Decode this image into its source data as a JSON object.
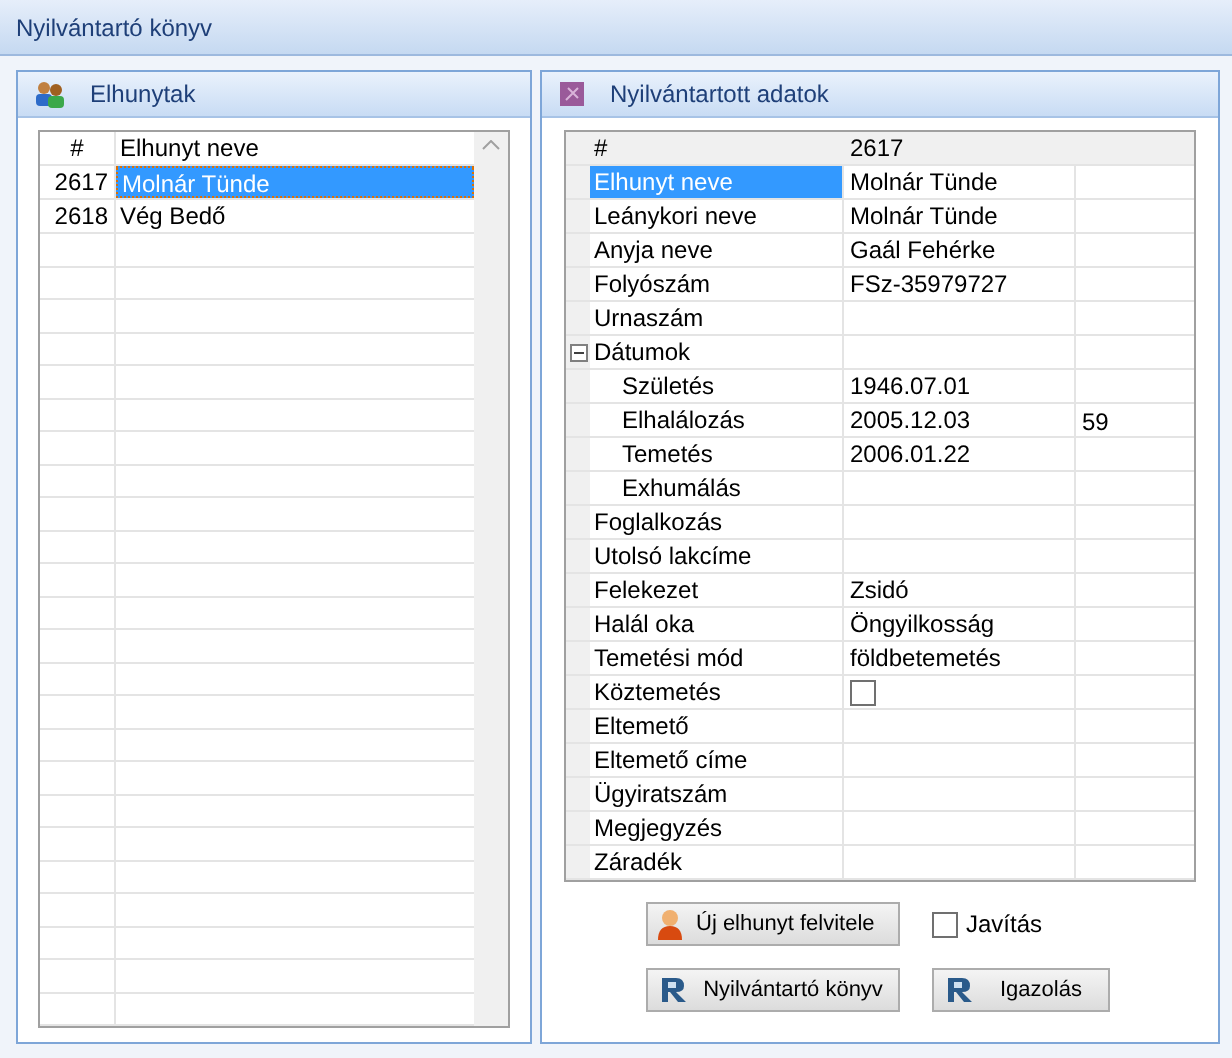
{
  "window": {
    "title": "Nyilvántartó könyv"
  },
  "left_panel": {
    "title": "Elhunytak",
    "columns": [
      "#",
      "Elhunyt neve"
    ],
    "rows": [
      {
        "id": "2617",
        "name": "Molnár Tünde",
        "selected": true
      },
      {
        "id": "2618",
        "name": "Vég Bedő",
        "selected": false
      }
    ]
  },
  "right_panel": {
    "title": "Nyilvántartott adatok",
    "header": {
      "label": "#",
      "value": "2617"
    },
    "properties": [
      {
        "kind": "text",
        "label": "Elhunyt neve",
        "value": "Molnár Tünde",
        "selected": true
      },
      {
        "kind": "text",
        "label": "Leánykori neve",
        "value": "Molnár Tünde",
        "selected": false
      },
      {
        "kind": "text",
        "label": "Anyja neve",
        "value": "Gaál Fehérke",
        "selected": false
      },
      {
        "kind": "text",
        "label": "Folyószám",
        "value": "FSz-35979727",
        "selected": false
      },
      {
        "kind": "text",
        "label": "Urnaszám",
        "selected": false
      },
      {
        "kind": "group",
        "label": "Dátumok",
        "expanded": true,
        "selected": false,
        "children": [
          {
            "kind": "text",
            "label": "Születés",
            "value": "1946.07.01",
            "selected": false
          },
          {
            "kind": "text",
            "label": "Elhalálozás",
            "value": "2005.12.03",
            "extra": "59",
            "selected": false
          },
          {
            "kind": "text",
            "label": "Temetés",
            "value": "2006.01.22",
            "selected": false
          },
          {
            "kind": "text",
            "label": "Exhumálás",
            "selected": false
          }
        ]
      },
      {
        "kind": "text",
        "label": "Foglalkozás",
        "selected": false
      },
      {
        "kind": "text",
        "label": "Utolsó lakcíme",
        "selected": false
      },
      {
        "kind": "text",
        "label": "Felekezet",
        "value": "Zsidó",
        "selected": false
      },
      {
        "kind": "text",
        "label": "Halál oka",
        "value": "Öngyilkosság",
        "selected": false
      },
      {
        "kind": "text",
        "label": "Temetési mód",
        "value": "földbetemetés",
        "selected": false
      },
      {
        "kind": "checkbox",
        "label": "Köztemetés",
        "checked": false,
        "selected": false
      },
      {
        "kind": "text",
        "label": "Eltemető",
        "selected": false
      },
      {
        "kind": "text",
        "label": "Eltemető címe",
        "selected": false
      },
      {
        "kind": "text",
        "label": "Ügyiratszám",
        "selected": false
      },
      {
        "kind": "text",
        "label": "Megjegyzés",
        "selected": false
      },
      {
        "kind": "text",
        "label": "Záradék",
        "selected": false
      }
    ],
    "new_button": "Új elhunyt felvitele",
    "edit_checkbox": {
      "label": "Javítás",
      "checked": false
    },
    "report_buttons": [
      "Nyilvántartó könyv",
      "Igazolás"
    ]
  }
}
